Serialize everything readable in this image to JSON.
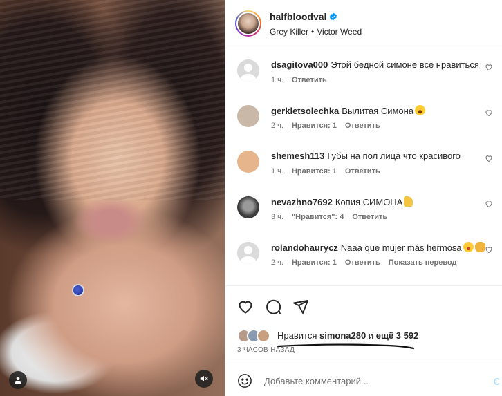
{
  "post": {
    "author": {
      "username": "halfbloodval",
      "verified": true,
      "audio_artist": "Grey Killer",
      "audio_track": "Victor Weed"
    }
  },
  "comments": [
    {
      "username": "dsagitova000",
      "text": "Этой бедной симоне все нравиться",
      "time": "1 ч.",
      "likes": "",
      "reply": "Ответить",
      "extra": "",
      "avatar": "default"
    },
    {
      "username": "gerkletsolechka",
      "text": "Вылитая Симона",
      "emoji": "e-wow",
      "time": "2 ч.",
      "likes": "Нравится: 1",
      "reply": "Ответить",
      "extra": "",
      "avatar": "#c9b8a8"
    },
    {
      "username": "shemesh113",
      "text": "Губы на пол лица что красивого",
      "time": "1 ч.",
      "likes": "Нравится: 1",
      "reply": "Ответить",
      "extra": "",
      "avatar": "#e6b58c"
    },
    {
      "username": "nevazhno7692",
      "text": "Копия СИМОНА",
      "emoji": "e-thumb",
      "time": "3 ч.",
      "likes": "\"Нравится\": 4",
      "reply": "Ответить",
      "extra": "",
      "avatar": "#3a3a3a"
    },
    {
      "username": "rolandohaurycz",
      "text": "Naaa que mujer más hermosa",
      "emoji": "e-star",
      "emoji2": "e-clap",
      "time": "2 ч.",
      "likes": "Нравится: 1",
      "reply": "Ответить",
      "extra": "Показать перевод",
      "avatar": "default"
    }
  ],
  "actions": {
    "like_icon": "heart-icon",
    "comment_icon": "comment-icon",
    "share_icon": "share-icon"
  },
  "likes": {
    "prefix": "Нравится",
    "user": "simona280",
    "middle": "и",
    "rest": "ещё 3 592"
  },
  "time_ago": "3 ЧАСОВ НАЗАД",
  "add_comment": {
    "placeholder": "Добавьте комментарий..."
  },
  "colors": {
    "text": "#262626",
    "secondary": "#737373",
    "verified": "#0095f6"
  }
}
